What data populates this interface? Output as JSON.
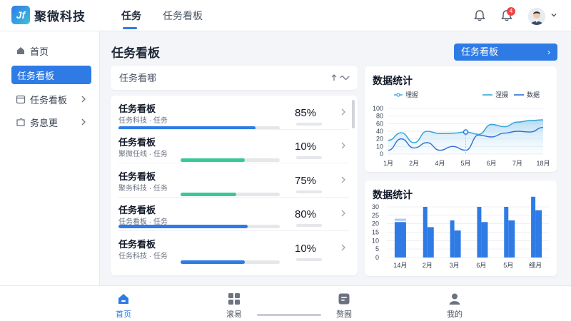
{
  "app": {
    "logo_mark": "Jf",
    "name": "聚微科技"
  },
  "top_tabs": [
    {
      "label": "任务",
      "active": true
    },
    {
      "label": "任务看板",
      "active": false
    }
  ],
  "header": {
    "notification_count": "4"
  },
  "sidebar": {
    "items": [
      {
        "label": "首页",
        "icon": "home-icon",
        "active": false,
        "chevron": false
      },
      {
        "label": "任务看板",
        "icon": "",
        "active": true,
        "chevron": false
      },
      {
        "label": "任务看板",
        "icon": "calendar-icon",
        "active": false,
        "chevron": true
      },
      {
        "label": "务息更",
        "icon": "puzzle-icon",
        "active": false,
        "chevron": true
      }
    ]
  },
  "main": {
    "title": "任务看板",
    "top_action_label": "任务看板",
    "search": {
      "placeholder": "任务看哪"
    },
    "tasks": [
      {
        "title": "任务看板",
        "subtitle": "任务科技 · 任务",
        "percent_label": "85%",
        "progress": 0.85,
        "color": "#2f7be6"
      },
      {
        "title": "任务看板",
        "subtitle": "聚微任线 · 任务",
        "percent_label": "10%",
        "progress": 0.1,
        "color": "#3cc79a"
      },
      {
        "title": "任务看板",
        "subtitle": "聚务科技 · 任务",
        "percent_label": "75%",
        "progress": 0.75,
        "color": "#3cc79a"
      },
      {
        "title": "任务看板",
        "subtitle": "任务看板 · 任务",
        "percent_label": "80%",
        "progress": 0.8,
        "color": "#2f7be6"
      },
      {
        "title": "任务看板",
        "subtitle": "任务科技 · 任务",
        "percent_label": "10%",
        "progress": 0.1,
        "color": "#2f7be6"
      }
    ]
  },
  "chart_data": [
    {
      "type": "area",
      "title": "数据统计",
      "categories": [
        "1月",
        "2月",
        "4月",
        "5月",
        "6月",
        "7月",
        "18月"
      ],
      "ylim": [
        0,
        100
      ],
      "yticks": [
        0,
        10,
        20,
        40,
        60,
        80,
        100
      ],
      "grid": true,
      "legend_placement": "top",
      "series": [
        {
          "name": "涅摄",
          "color": "#3ba7d9",
          "values": [
            18,
            36,
            15,
            40,
            34,
            35,
            38,
            32,
            58,
            52,
            64,
            68,
            70
          ]
        },
        {
          "name": "数据",
          "color": "#2f6fd6",
          "values": [
            5,
            20,
            8,
            15,
            5,
            10,
            5,
            30,
            25,
            35,
            40,
            38,
            50
          ]
        }
      ],
      "legend_extra": "埋握"
    },
    {
      "type": "bar",
      "title": "数据统计",
      "categories": [
        "14月",
        "2月",
        "3月",
        "6月",
        "5月",
        "细月"
      ],
      "ylim": [
        0,
        30
      ],
      "yticks": [
        0,
        5,
        10,
        15,
        20,
        25,
        30
      ],
      "grid": true,
      "series": [
        {
          "name": "",
          "color": "#2f7be6",
          "values": [
            23,
            30,
            22,
            30,
            30,
            36
          ]
        },
        {
          "name": "",
          "color": "#2f7be6",
          "values": [
            21,
            18,
            16,
            21,
            22,
            28
          ]
        }
      ]
    }
  ],
  "bottom_nav": [
    {
      "label": "首页",
      "icon": "home-icon",
      "active": true
    },
    {
      "label": "滚易",
      "icon": "grid-icon",
      "active": false
    },
    {
      "label": "赘囿",
      "icon": "document-icon",
      "active": false
    },
    {
      "label": "我的",
      "icon": "user-icon",
      "active": false
    }
  ]
}
